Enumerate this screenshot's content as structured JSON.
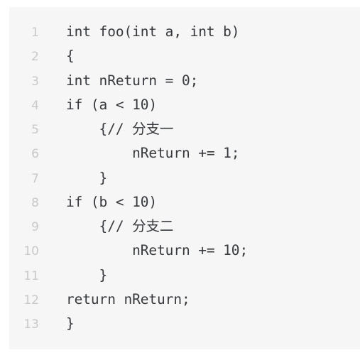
{
  "code_block": {
    "language": "c",
    "background_color": "#f6f6f6",
    "page_background_color": "#ffffff",
    "text_color": "#36393d",
    "line_number_color": "#c9c9c9",
    "line_count": 13,
    "lines": [
      {
        "number": "1",
        "text": "int foo(int a, int b)"
      },
      {
        "number": "2",
        "text": "{"
      },
      {
        "number": "3",
        "text": "int nReturn = 0;"
      },
      {
        "number": "4",
        "text": "if (a < 10)"
      },
      {
        "number": "5",
        "text": "    {// 分支一"
      },
      {
        "number": "6",
        "text": "        nReturn += 1;"
      },
      {
        "number": "7",
        "text": "    }"
      },
      {
        "number": "8",
        "text": "if (b < 10)"
      },
      {
        "number": "9",
        "text": "    {// 分支二"
      },
      {
        "number": "10",
        "text": "        nReturn += 10;"
      },
      {
        "number": "11",
        "text": "    }"
      },
      {
        "number": "12",
        "text": "return nReturn;"
      },
      {
        "number": "13",
        "text": "}"
      }
    ]
  }
}
